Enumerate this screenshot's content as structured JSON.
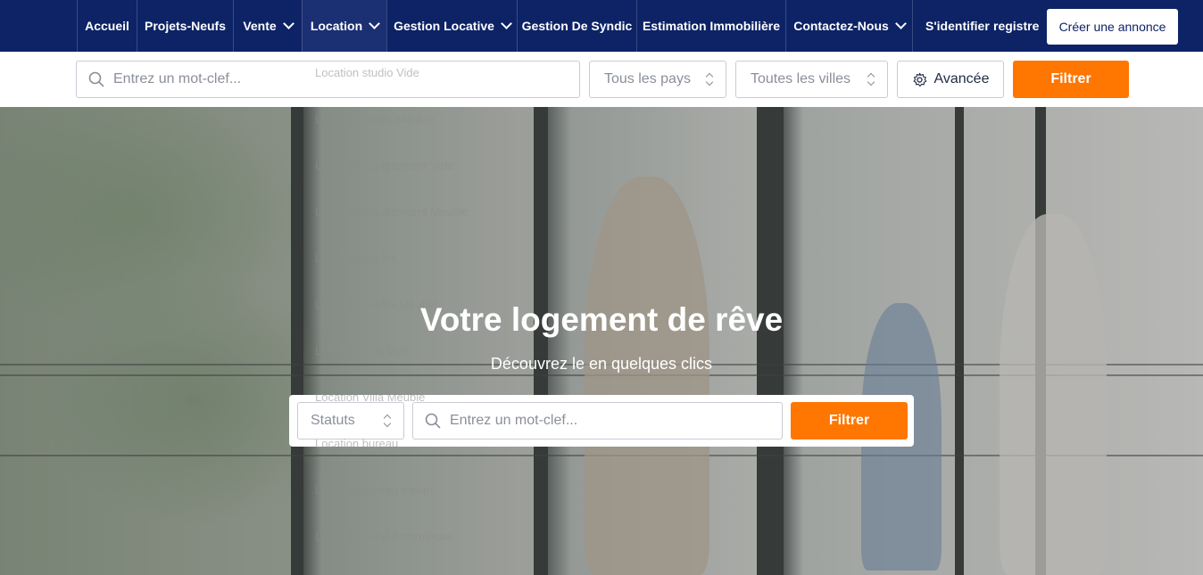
{
  "nav": {
    "items": [
      {
        "label": "Accueil",
        "dropdown": false
      },
      {
        "label": "Projets-Neufs",
        "dropdown": false
      },
      {
        "label": "Vente",
        "dropdown": true
      },
      {
        "label": "Location",
        "dropdown": true
      },
      {
        "label": "Gestion Locative",
        "dropdown": true
      },
      {
        "label": "Gestion De Syndic",
        "dropdown": false
      },
      {
        "label": "Estimation Immobilière",
        "dropdown": false
      },
      {
        "label": "Contactez-Nous",
        "dropdown": true
      }
    ],
    "login": "S'identifier",
    "register": "registre",
    "create_button": "Créer une annonce"
  },
  "location_menu": {
    "items": [
      "Location studio Vide",
      "Location studio Meublé",
      "Location appartement Vide",
      "Location appartement Meublé",
      "Location duplex",
      "Location duplex Meublé",
      "Location Villa Vide",
      "Location Villa Meublé",
      "Location bureau",
      "Location bureau équipé",
      "Location Local commercial"
    ]
  },
  "search": {
    "keyword_placeholder": "Entrez un mot-clef...",
    "country_select": "Tous les pays",
    "city_select": "Toutes les villes",
    "advanced_label": "Avancée",
    "filter_label": "Filtrer"
  },
  "hero": {
    "title": "Votre logement de rêve",
    "subtitle": "Découvrez le en quelques clics",
    "status_select": "Statuts",
    "keyword_placeholder": "Entrez un mot-clef...",
    "filter_label": "Filtrer"
  },
  "colors": {
    "nav_bg": "#0d2366",
    "accent": "#ff7600"
  }
}
